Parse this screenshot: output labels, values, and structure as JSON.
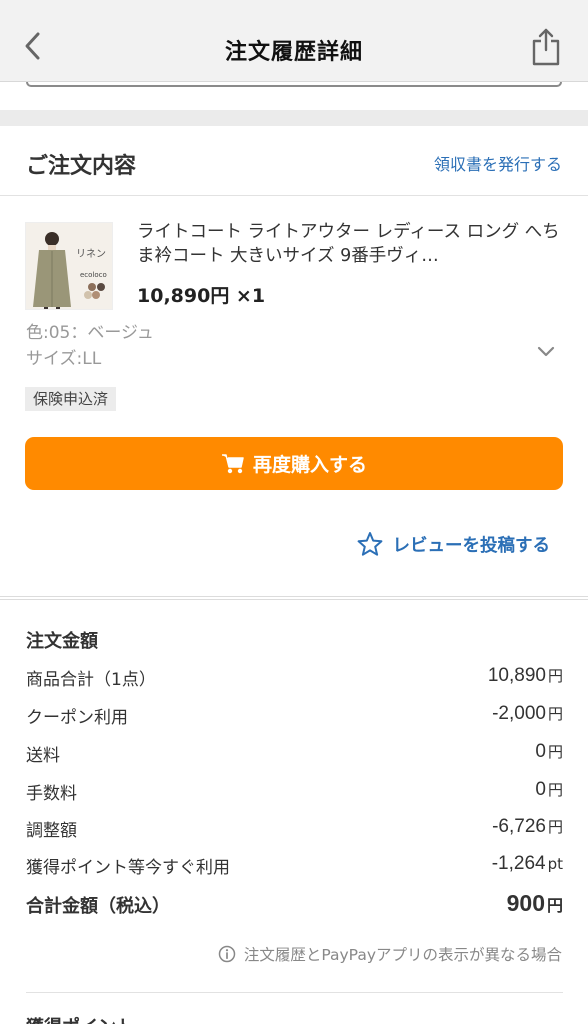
{
  "nav": {
    "title": "注文履歴詳細",
    "back_icon": "chevron-left-icon",
    "share_icon": "share-icon"
  },
  "order_contents": {
    "title": "ご注文内容",
    "receipt_link": "領収書を発行する"
  },
  "product": {
    "thumbnail_text": [
      "リネン",
      "ecoloco"
    ],
    "title": "ライトコート ライトアウター レディース ロング へちま衿コート 大きいサイズ 9番手ヴィ…",
    "price": "10,890円 ×1",
    "color": "色:05：ベージュ",
    "size": "サイズ:LL",
    "badge": "保険申込済"
  },
  "actions": {
    "rebuy": "再度購入する",
    "review": "レビューを投稿する"
  },
  "summary": {
    "title": "注文金額",
    "rows": [
      {
        "label": "商品合計（1点）",
        "value": "10,890",
        "unit": "円"
      },
      {
        "label": "クーポン利用",
        "value": "-2,000",
        "unit": "円"
      },
      {
        "label": "送料",
        "value": "0",
        "unit": "円"
      },
      {
        "label": "手数料",
        "value": "0",
        "unit": "円"
      },
      {
        "label": "調整額",
        "value": "-6,726",
        "unit": "円"
      },
      {
        "label": "獲得ポイント等今すぐ利用",
        "value": "-1,264",
        "unit": "pt"
      }
    ],
    "total": {
      "label": "合計金額（税込）",
      "value": "900",
      "unit": "円"
    },
    "note": "注文履歴とPayPayアプリの表示が異なる場合"
  },
  "next_section": {
    "title": "獲得ポイント"
  },
  "colors": {
    "accent_orange": "#ff8a00",
    "link_blue": "#2b6fb6"
  }
}
